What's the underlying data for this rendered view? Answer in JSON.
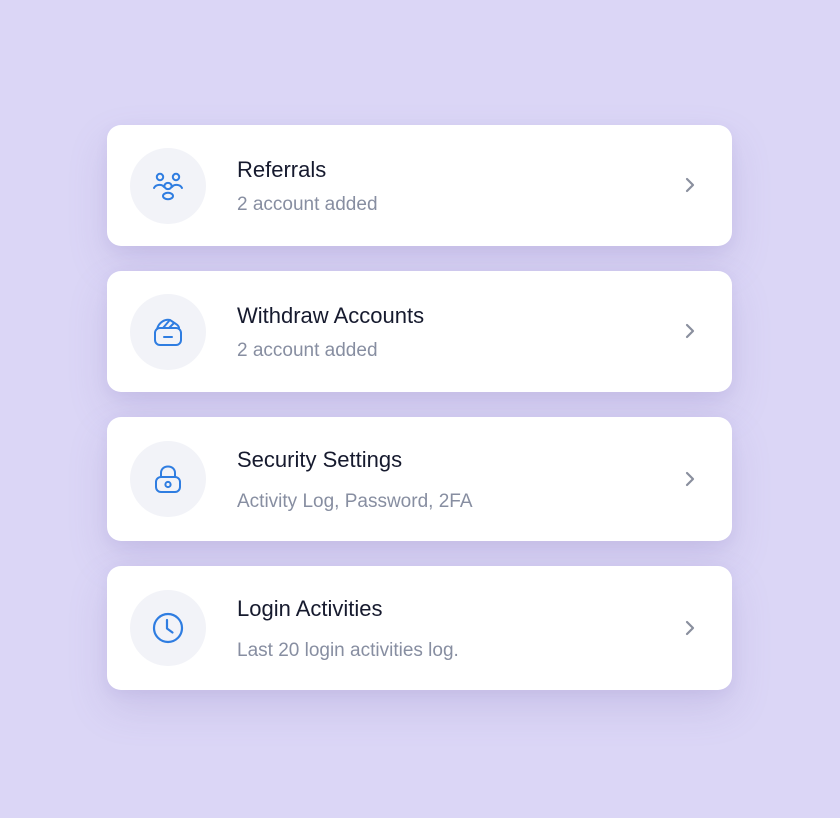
{
  "menu": {
    "items": [
      {
        "title": "Referrals",
        "subtitle": "2 account added",
        "icon": "users-group-icon"
      },
      {
        "title": "Withdraw Accounts",
        "subtitle": "2 account added",
        "icon": "wallet-icon"
      },
      {
        "title": "Security Settings",
        "subtitle": "Activity Log, Password, 2FA",
        "icon": "lock-icon"
      },
      {
        "title": "Login Activities",
        "subtitle": "Last 20 login activities log.",
        "icon": "clock-icon"
      }
    ]
  },
  "colors": {
    "background": "#dbd6f6",
    "card": "#ffffff",
    "icon_accent": "#2f7de1",
    "title": "#161a2e",
    "subtitle": "#878ea1",
    "chevron": "#8a8f9e"
  }
}
